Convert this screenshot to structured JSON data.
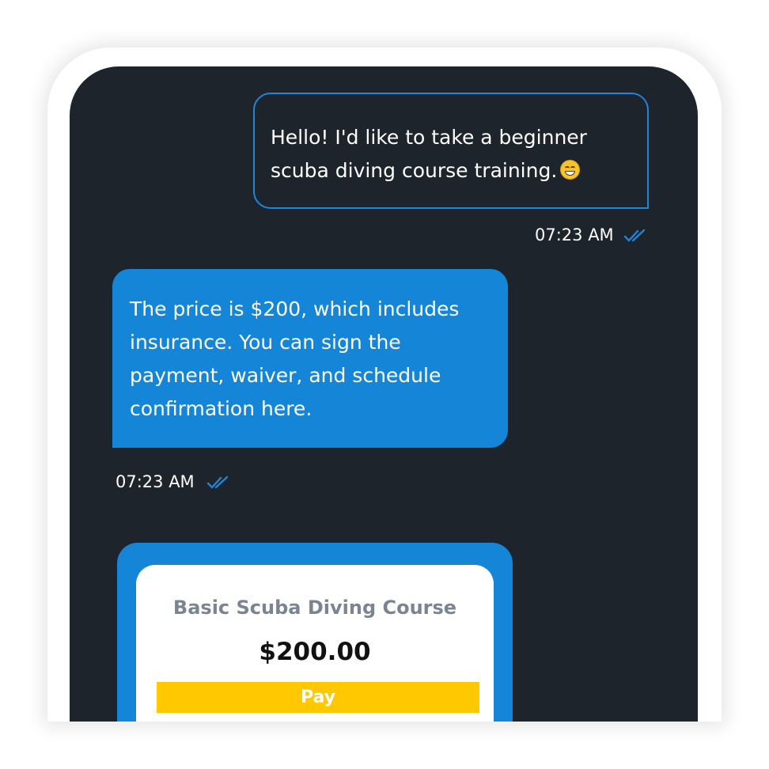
{
  "messages": {
    "outgoing": {
      "text": "Hello! I'd like to take a beginner scuba diving course training.",
      "emoji": "grinning-face-icon",
      "time": "07:23 AM",
      "status": "read"
    },
    "incoming": {
      "text": "The price is $200, which includes insurance. You can sign the payment, waiver, and schedule confirmation here.",
      "time": "07:23 AM",
      "status": "read"
    }
  },
  "payment_card": {
    "title": "Basic Scuba Diving Course",
    "price": "$200.00",
    "button_label": "Pay"
  },
  "colors": {
    "screen_background": "#1e242c",
    "accent_blue": "#1585d8",
    "pay_button": "#ffc800",
    "title_gray": "#7a8593"
  }
}
